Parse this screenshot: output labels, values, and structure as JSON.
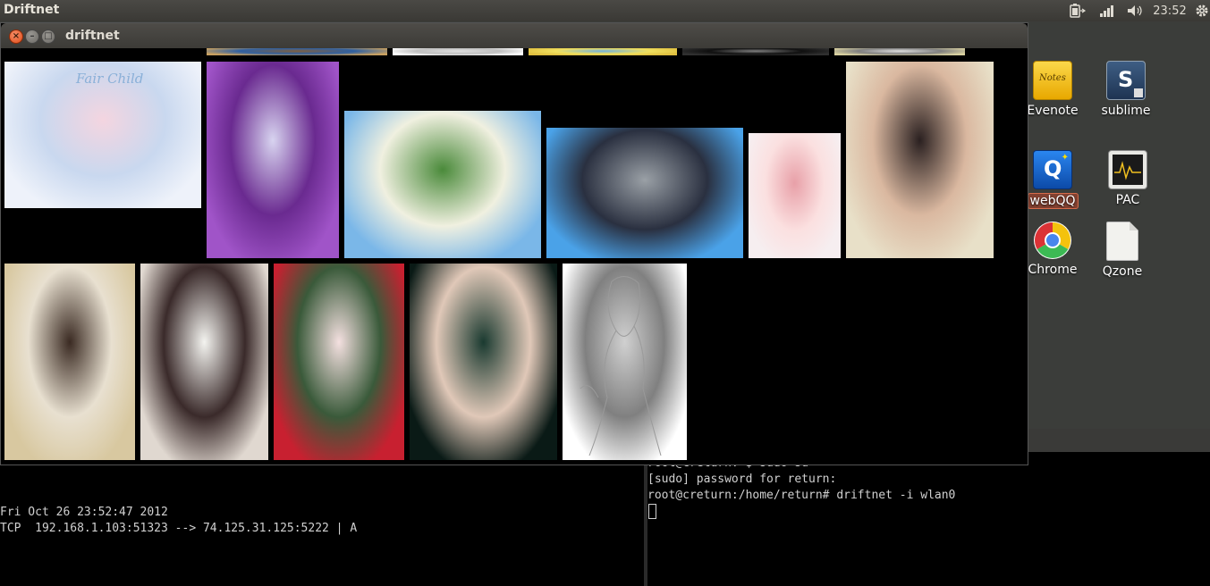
{
  "top_panel": {
    "app_name": "Driftnet",
    "clock": "23:52"
  },
  "driftnet_window": {
    "title": "driftnet",
    "thumbnails": [
      {
        "name": "anime-illustration-fair-child",
        "caption": "Fair Child",
        "colors": [
          "#eef2fa",
          "#f4d5e0",
          "#c9d8ef"
        ]
      },
      {
        "name": "woman-in-white-dress-purple",
        "caption": "",
        "colors": [
          "#a054c8",
          "#d8d4f0",
          "#6a2a90"
        ]
      },
      {
        "name": "3d-game-character-bamboo",
        "caption": "",
        "colors": [
          "#7ab7e8",
          "#4a8a3a",
          "#f0f0e0"
        ]
      },
      {
        "name": "models-with-suv-car",
        "caption": "",
        "colors": [
          "#4aa2e8",
          "#9aa0a6",
          "#2a3040"
        ]
      },
      {
        "name": "woman-pink-outfit",
        "caption": "",
        "colors": [
          "#f6eef0",
          "#e8a0a8",
          "#fbe0e0"
        ]
      },
      {
        "name": "woman-selfie-black-hair",
        "caption": "",
        "colors": [
          "#e8e0c8",
          "#2a2020",
          "#dab8a0"
        ]
      },
      {
        "name": "woman-on-sofa-phone",
        "caption": "",
        "colors": [
          "#d8c8a0",
          "#3a2a22",
          "#e8e0d0"
        ]
      },
      {
        "name": "two-women-white-blouses",
        "caption": "",
        "colors": [
          "#e0d8d0",
          "#f4f4f0",
          "#3a2a2a"
        ]
      },
      {
        "name": "woman-christmas-outfit",
        "caption": "",
        "colors": [
          "#c82030",
          "#f4e0e0",
          "#3a5a3a"
        ]
      },
      {
        "name": "woman-dark-green-hair",
        "caption": "",
        "colors": [
          "#0a1a16",
          "#1a3a30",
          "#e0c8b8"
        ]
      },
      {
        "name": "pencil-sketch-woman",
        "caption": "",
        "colors": [
          "#ffffff",
          "#d0d0d0",
          "#808080"
        ]
      },
      {
        "name": "partial-image-1",
        "caption": "",
        "colors": [
          "#c8a060",
          "#806040",
          "#3060a0"
        ]
      },
      {
        "name": "partial-image-2",
        "caption": "",
        "colors": [
          "#ffffff",
          "#e0e0e0",
          "#c0c0c0"
        ]
      },
      {
        "name": "partial-image-3",
        "caption": "",
        "colors": [
          "#e0c040",
          "#70b0e0",
          "#f0e060"
        ]
      },
      {
        "name": "partial-image-4",
        "caption": "",
        "colors": [
          "#303030",
          "#808080",
          "#101010"
        ]
      },
      {
        "name": "partial-image-5",
        "caption": "",
        "colors": [
          "#d8d0a0",
          "#e0e0e0",
          "#808080"
        ]
      }
    ]
  },
  "desktop_icons": [
    {
      "label": "Evenote",
      "icon": "evernote-icon",
      "color": "#f6c40c"
    },
    {
      "label": "sublime",
      "icon": "sublime-text-icon",
      "color": "#2e4a6a"
    },
    {
      "label": "webQQ",
      "icon": "webqq-icon",
      "color": "#1a6ad0"
    },
    {
      "label": "PAC",
      "icon": "pac-monitor-icon",
      "color": "#303030"
    },
    {
      "label": "Chrome",
      "icon": "chrome-icon",
      "color": "#dd4b39"
    },
    {
      "label": "Qzone",
      "icon": "document-icon",
      "color": "#f0f0ec"
    }
  ],
  "terminal_left": {
    "lines": [
      "Fri Oct 26 23:52:47 2012",
      "TCP  192.168.1.103:51323 --> 74.125.31.125:5222 | A"
    ]
  },
  "terminal_right": {
    "lines": [
      "root@creturn:~$ sudo su",
      "[sudo] password for return:",
      "root@creturn:/home/return# driftnet -i wlan0"
    ]
  }
}
